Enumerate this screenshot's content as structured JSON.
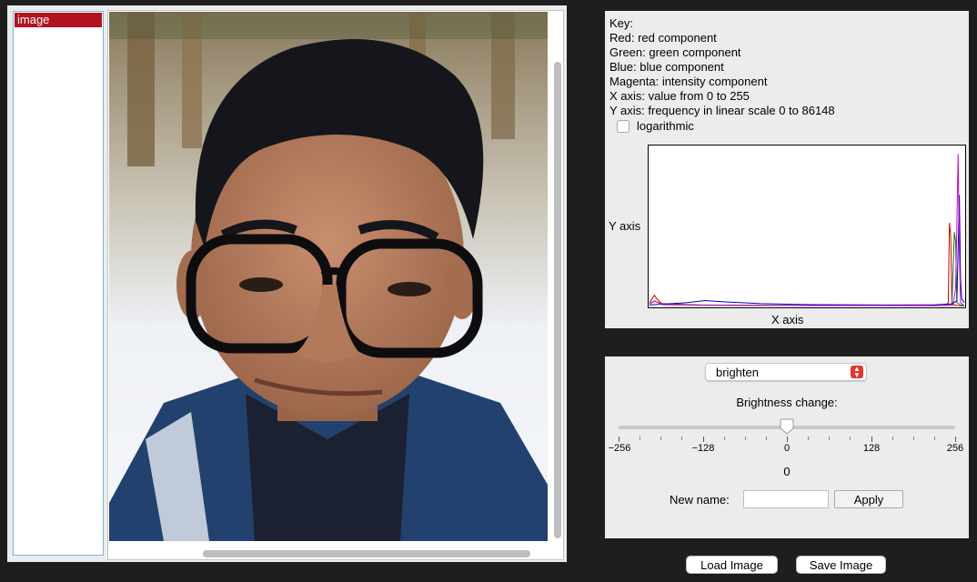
{
  "image_list": {
    "items": [
      "image"
    ]
  },
  "histogram": {
    "key_lines": [
      "Key:",
      "Red: red component",
      "Green: green component",
      "Blue: blue component",
      "Magenta: intensity component",
      "X axis: value from 0 to 255",
      "Y axis: frequency in linear scale 0 to 86148"
    ],
    "log_label": "logarithmic",
    "log_checked": false,
    "y_axis_label": "Y axis",
    "x_axis_label": "X axis",
    "colors": {
      "red": "#d00000",
      "green": "#008000",
      "blue": "#0000d0",
      "magenta": "#cc00cc"
    }
  },
  "chart_data": {
    "type": "line",
    "xlim": [
      0,
      255
    ],
    "ylim": [
      0,
      86148
    ],
    "series": [
      {
        "name": "Red: red component",
        "points": [
          [
            0,
            2000
          ],
          [
            2,
            4000
          ],
          [
            4,
            6000
          ],
          [
            6,
            4000
          ],
          [
            10,
            1500
          ],
          [
            40,
            800
          ],
          [
            100,
            500
          ],
          [
            180,
            500
          ],
          [
            230,
            400
          ],
          [
            240,
            600
          ],
          [
            242,
            2000
          ],
          [
            243,
            45000
          ],
          [
            244,
            38000
          ],
          [
            245,
            3000
          ],
          [
            246,
            1000
          ],
          [
            250,
            500
          ],
          [
            255,
            300
          ]
        ]
      },
      {
        "name": "Green: green component",
        "points": [
          [
            0,
            1500
          ],
          [
            4,
            3000
          ],
          [
            10,
            1200
          ],
          [
            40,
            800
          ],
          [
            100,
            600
          ],
          [
            200,
            500
          ],
          [
            240,
            500
          ],
          [
            245,
            1000
          ],
          [
            247,
            40000
          ],
          [
            248,
            35000
          ],
          [
            249,
            2000
          ],
          [
            252,
            800
          ],
          [
            255,
            400
          ]
        ]
      },
      {
        "name": "Blue: blue component",
        "points": [
          [
            0,
            800
          ],
          [
            10,
            1200
          ],
          [
            30,
            2000
          ],
          [
            45,
            3200
          ],
          [
            60,
            2500
          ],
          [
            90,
            1500
          ],
          [
            130,
            1000
          ],
          [
            190,
            800
          ],
          [
            230,
            900
          ],
          [
            245,
            1400
          ],
          [
            249,
            3000
          ],
          [
            250,
            30000
          ],
          [
            251,
            60000
          ],
          [
            252,
            14000
          ],
          [
            253,
            4000
          ],
          [
            255,
            2000
          ]
        ]
      },
      {
        "name": "Magenta: intensity component",
        "points": [
          [
            0,
            1200
          ],
          [
            4,
            3000
          ],
          [
            10,
            1000
          ],
          [
            40,
            700
          ],
          [
            100,
            500
          ],
          [
            200,
            500
          ],
          [
            240,
            600
          ],
          [
            246,
            800
          ],
          [
            248,
            10000
          ],
          [
            249,
            45000
          ],
          [
            250,
            82000
          ],
          [
            251,
            30000
          ],
          [
            252,
            2000
          ],
          [
            255,
            500
          ]
        ]
      }
    ]
  },
  "filter_panel": {
    "filter_select": "brighten",
    "brightness_label": "Brightness change:",
    "slider": {
      "min": -256,
      "max": 256,
      "value": 0,
      "tick_labels": [
        "−256",
        "−128",
        "0",
        "128",
        "256"
      ]
    },
    "value_text": "0",
    "new_name_label": "New name:",
    "new_name_value": "",
    "apply_label": "Apply"
  },
  "buttons": {
    "load": "Load Image",
    "save": "Save Image"
  }
}
